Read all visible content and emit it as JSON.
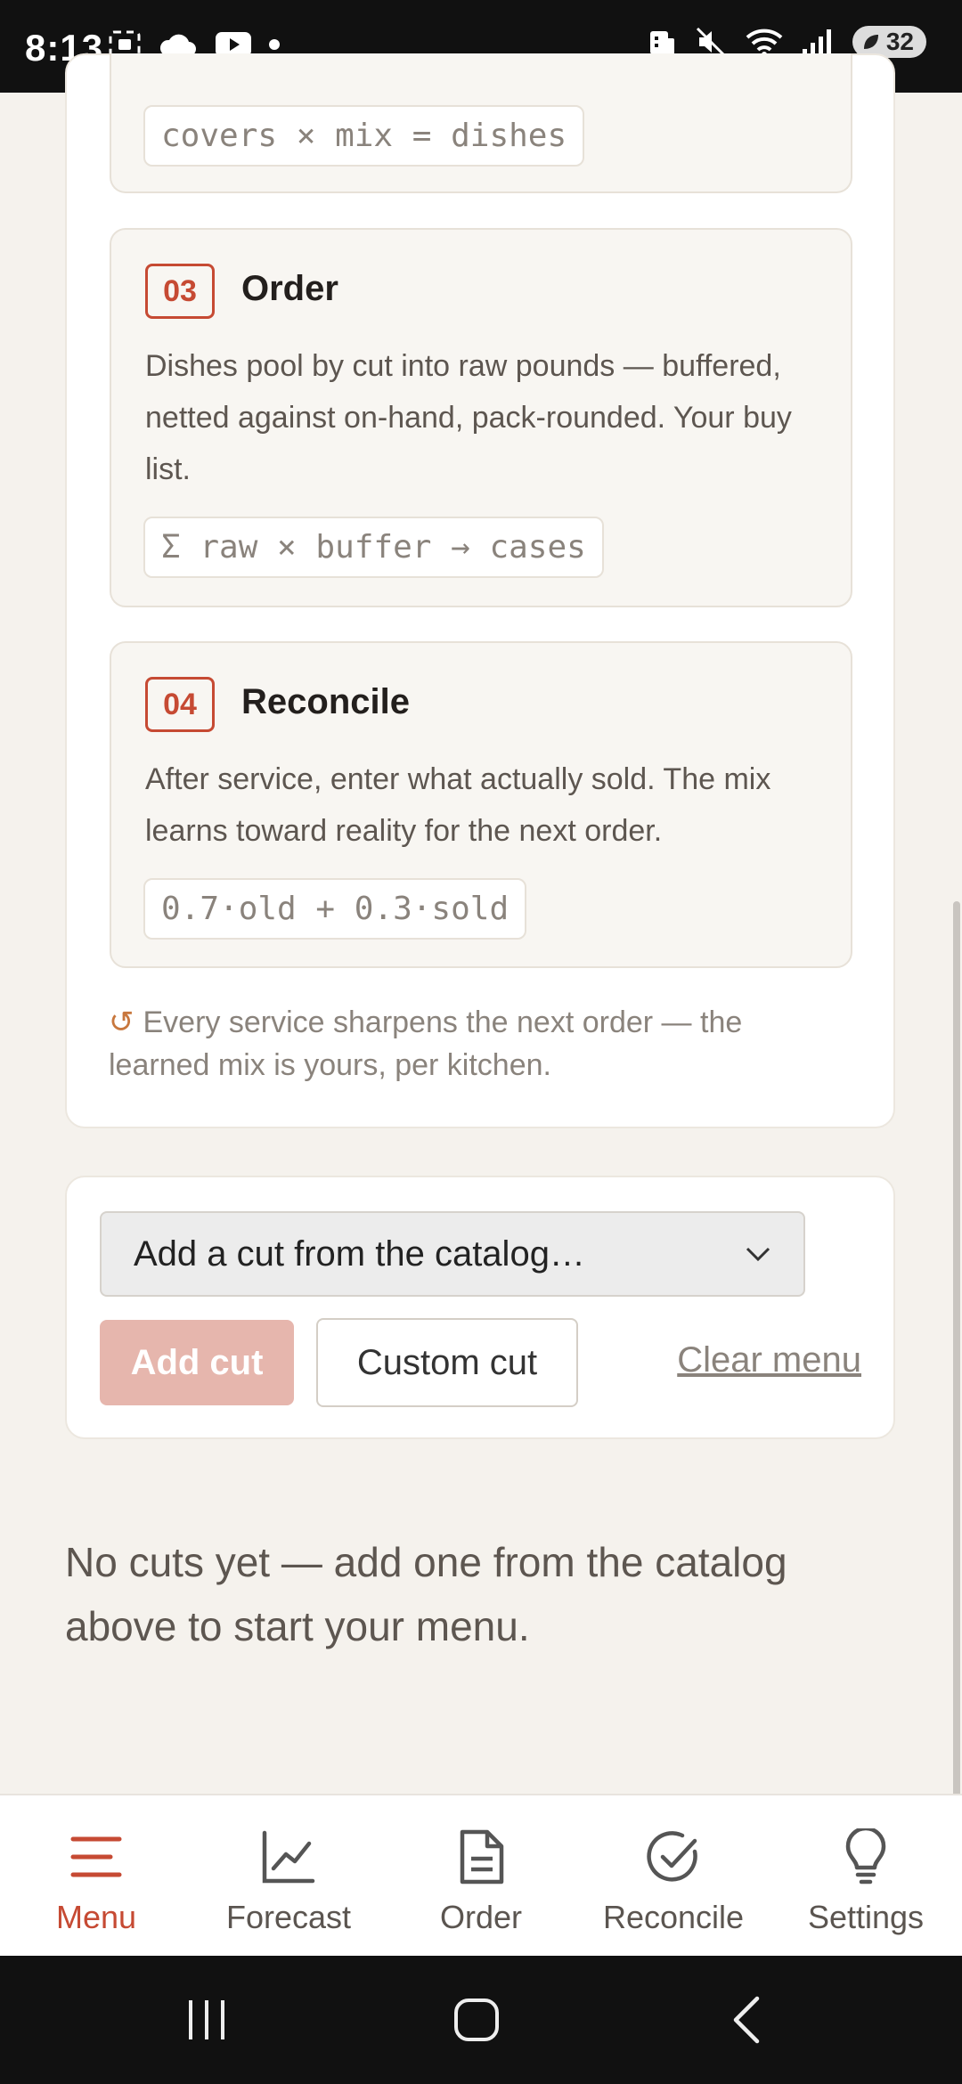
{
  "status_bar": {
    "time": "8:13",
    "battery": "32"
  },
  "steps": [
    {
      "code": "covers × mix = dishes"
    },
    {
      "number": "03",
      "title": "Order",
      "body": "Dishes pool by cut into raw pounds — buffered, netted against on-hand, pack-rounded. Your buy list.",
      "code": "Σ raw × buffer → cases"
    },
    {
      "number": "04",
      "title": "Reconcile",
      "body": "After service, enter what actually sold. The mix learns toward reality for the next order.",
      "code": "0.7·old + 0.3·sold"
    }
  ],
  "footnote": {
    "icon": "↺",
    "text": "Every service sharpens the next order — the learned mix is yours, per kitchen."
  },
  "add_cut": {
    "select_label": "Add a cut from the catalog…",
    "add_button": "Add cut",
    "custom_button": "Custom cut",
    "clear_link": "Clear menu"
  },
  "empty_message": "No cuts yet — add one from the catalog above to start your menu.",
  "bottom_nav": [
    {
      "label": "Menu",
      "icon": "menu-icon",
      "active": true
    },
    {
      "label": "Forecast",
      "icon": "chart-icon",
      "active": false
    },
    {
      "label": "Order",
      "icon": "document-icon",
      "active": false
    },
    {
      "label": "Reconcile",
      "icon": "check-circle-icon",
      "active": false
    },
    {
      "label": "Settings",
      "icon": "lightbulb-icon",
      "active": false
    }
  ],
  "colors": {
    "accent": "#c64a33",
    "add_button_disabled": "#e6b6ad",
    "background": "#f5f2ed"
  }
}
